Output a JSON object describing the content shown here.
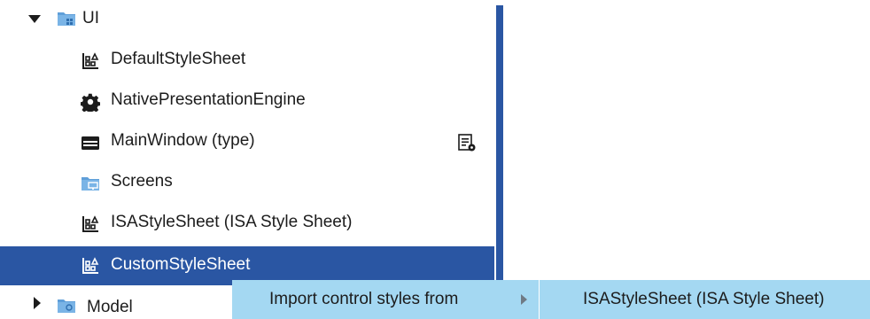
{
  "tree": {
    "ui_folder": {
      "label": "UI",
      "expanded": true,
      "icon": "folder-icon"
    },
    "items": [
      {
        "label": "DefaultStyleSheet",
        "icon": "stylesheet-icon"
      },
      {
        "label": "NativePresentationEngine",
        "icon": "gear-icon"
      },
      {
        "label": "MainWindow (type)",
        "icon": "window-icon",
        "trailing_icon": "properties-icon"
      },
      {
        "label": "Screens",
        "icon": "screens-folder-icon"
      },
      {
        "label": "ISAStyleSheet (ISA Style Sheet)",
        "icon": "stylesheet-icon"
      },
      {
        "label": "CustomStyleSheet",
        "icon": "stylesheet-icon",
        "selected": true
      }
    ],
    "model_folder": {
      "label": "Model",
      "expanded": false,
      "icon": "model-folder-icon"
    }
  },
  "context_menu": {
    "item": "Import control styles from",
    "submenu_item": "ISAStyleSheet (ISA Style Sheet)"
  },
  "colors": {
    "selection": "#2a56a3",
    "menu_background": "#a4d8f2",
    "folder": "#5f9fd9"
  }
}
